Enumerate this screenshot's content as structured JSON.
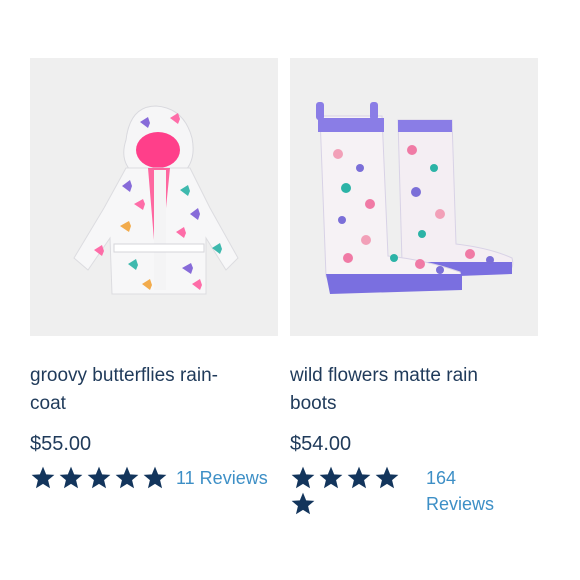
{
  "products": [
    {
      "name": "groovy butterflies rain-coat",
      "name_line1": "groovy butterflies rain-",
      "name_line2": "coat",
      "price": "$55.00",
      "rating": 5,
      "reviews": "11 Reviews",
      "image": "raincoat-image"
    },
    {
      "name": "wild flowers matte rain boots",
      "name_line1": "wild flowers matte rain",
      "name_line2": "boots",
      "price": "$54.00",
      "rating": 5,
      "reviews_count": "164",
      "reviews_word": "Reviews",
      "image": "rain-boots-image"
    }
  ],
  "colors": {
    "star": "#13355c",
    "text": "#1f3a5a",
    "link": "#3d8fc6",
    "image_bg": "#efefef"
  }
}
